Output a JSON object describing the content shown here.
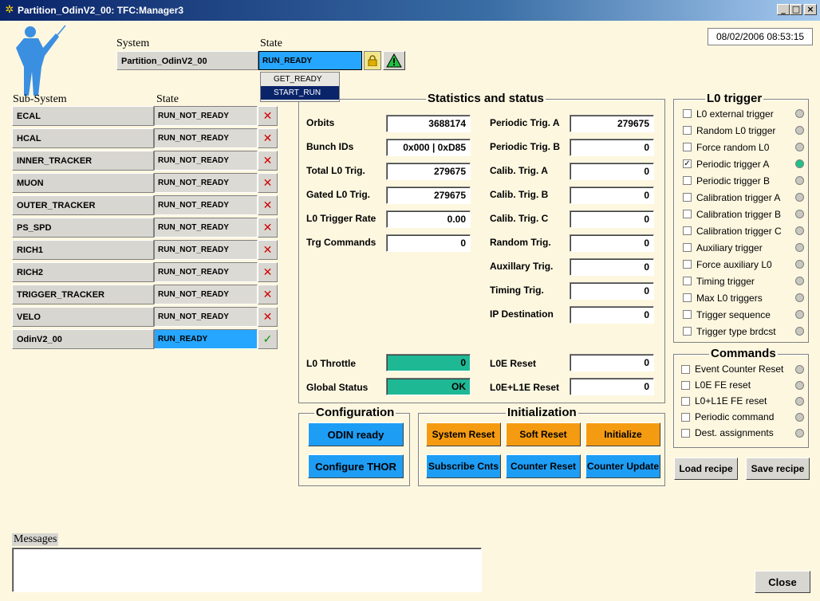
{
  "window": {
    "title": "Partition_OdinV2_00: TFC:Manager3",
    "icon": "app-icon",
    "minimize_label": "_",
    "maximize_label": "□",
    "close_label": "×"
  },
  "datetime": "08/02/2006  08:53:15",
  "system": {
    "header": "System",
    "state_header": "State",
    "name": "Partition_OdinV2_00",
    "state": "RUN_READY",
    "state_options": [
      "GET_READY",
      "START_RUN"
    ],
    "selected_option": "START_RUN"
  },
  "subsystems": {
    "header": "Sub-System",
    "state_header": "State",
    "rows": [
      {
        "name": "ECAL",
        "state": "RUN_NOT_READY",
        "ok": false
      },
      {
        "name": "HCAL",
        "state": "RUN_NOT_READY",
        "ok": false
      },
      {
        "name": "INNER_TRACKER",
        "state": "RUN_NOT_READY",
        "ok": false
      },
      {
        "name": "MUON",
        "state": "RUN_NOT_READY",
        "ok": false
      },
      {
        "name": "OUTER_TRACKER",
        "state": "RUN_NOT_READY",
        "ok": false
      },
      {
        "name": "PS_SPD",
        "state": "RUN_NOT_READY",
        "ok": false
      },
      {
        "name": "RICH1",
        "state": "RUN_NOT_READY",
        "ok": false
      },
      {
        "name": "RICH2",
        "state": "RUN_NOT_READY",
        "ok": false
      },
      {
        "name": "TRIGGER_TRACKER",
        "state": "RUN_NOT_READY",
        "ok": false
      },
      {
        "name": "VELO",
        "state": "RUN_NOT_READY",
        "ok": false
      },
      {
        "name": "OdinV2_00",
        "state": "RUN_READY",
        "ok": true
      }
    ],
    "x_mark": "✕",
    "check_mark": "✓"
  },
  "stats": {
    "title": "Statistics and status",
    "left": [
      {
        "label": "Orbits",
        "value": "3688174"
      },
      {
        "label": "Bunch IDs",
        "value": "0x000 | 0xD85"
      },
      {
        "label": "Total L0 Trig.",
        "value": "279675"
      },
      {
        "label": "Gated L0 Trig.",
        "value": "279675"
      },
      {
        "label": "L0 Trigger Rate",
        "value": "0.00"
      },
      {
        "label": "Trg Commands",
        "value": "0"
      }
    ],
    "right": [
      {
        "label": "Periodic Trig. A",
        "value": "279675"
      },
      {
        "label": "Periodic Trig. B",
        "value": "0"
      },
      {
        "label": "Calib. Trig. A",
        "value": "0"
      },
      {
        "label": "Calib. Trig. B",
        "value": "0"
      },
      {
        "label": "Calib. Trig. C",
        "value": "0"
      },
      {
        "label": "Random Trig.",
        "value": "0"
      },
      {
        "label": "Auxillary Trig.",
        "value": "0"
      },
      {
        "label": "Timing Trig.",
        "value": "0"
      },
      {
        "label": "IP Destination",
        "value": "0"
      }
    ],
    "l0_throttle": {
      "label": "L0 Throttle",
      "value": "0"
    },
    "global_status": {
      "label": "Global Status",
      "value": "OK"
    },
    "l0e_reset": {
      "label": "L0E Reset",
      "value": "0"
    },
    "l0e_l1e_reset": {
      "label": "L0E+L1E Reset",
      "value": "0"
    }
  },
  "l0_trigger": {
    "title": "L0 trigger",
    "items": [
      {
        "label": "L0 external trigger",
        "checked": false,
        "led_on": false
      },
      {
        "label": "Random L0 trigger",
        "checked": false,
        "led_on": false
      },
      {
        "label": "Force random L0",
        "checked": false,
        "led_on": false
      },
      {
        "label": "Periodic trigger A",
        "checked": true,
        "led_on": true
      },
      {
        "label": "Periodic trigger B",
        "checked": false,
        "led_on": false
      },
      {
        "label": "Calibration trigger A",
        "checked": false,
        "led_on": false
      },
      {
        "label": "Calibration trigger B",
        "checked": false,
        "led_on": false
      },
      {
        "label": "Calibration trigger C",
        "checked": false,
        "led_on": false
      },
      {
        "label": "Auxiliary trigger",
        "checked": false,
        "led_on": false
      },
      {
        "label": "Force auxiliary L0",
        "checked": false,
        "led_on": false
      },
      {
        "label": "Timing trigger",
        "checked": false,
        "led_on": false
      },
      {
        "label": "Max L0 triggers",
        "checked": false,
        "led_on": false
      },
      {
        "label": "Trigger sequence",
        "checked": false,
        "led_on": false
      },
      {
        "label": "Trigger type brdcst",
        "checked": false,
        "led_on": false
      }
    ]
  },
  "commands": {
    "title": "Commands",
    "items": [
      {
        "label": "Event Counter Reset",
        "checked": false
      },
      {
        "label": "L0E FE reset",
        "checked": false
      },
      {
        "label": "L0+L1E FE reset",
        "checked": false
      },
      {
        "label": "Periodic command",
        "checked": false
      },
      {
        "label": "Dest. assignments",
        "checked": false
      }
    ]
  },
  "configuration": {
    "title": "Configuration",
    "odin_ready": "ODIN ready",
    "configure_thor": "Configure THOR"
  },
  "initialization": {
    "title": "Initialization",
    "system_reset": "System Reset",
    "soft_reset": "Soft Reset",
    "initialize": "Initialize",
    "subscribe_cnts": "Subscribe Cnts",
    "counter_reset": "Counter Reset",
    "counter_update": "Counter Update"
  },
  "recipes": {
    "load": "Load recipe",
    "save": "Save recipe"
  },
  "messages": {
    "label": "Messages",
    "text": ""
  },
  "close_button": "Close",
  "check_glyph": "✓",
  "colors": {
    "background": "#fdf7e0",
    "ready": "#26a6ff",
    "button_blue": "#1e9df5",
    "button_orange": "#f59b12",
    "status_green": "#1fb895",
    "error_red": "#d00000"
  }
}
